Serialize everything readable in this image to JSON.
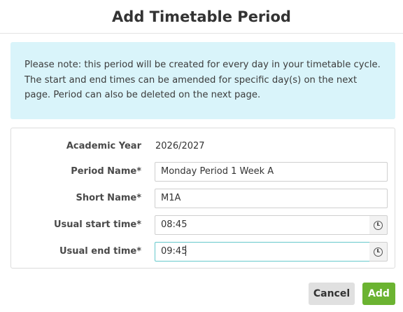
{
  "dialog": {
    "title": "Add Timetable Period"
  },
  "notice": {
    "text": "Please note: this period will be created for every day in your timetable cycle. The start and end times can be amended for specific day(s) on the next page. Period can also be deleted on the next page."
  },
  "form": {
    "academic_year_label": "Academic Year",
    "academic_year_value": "2026/2027",
    "period_name_label": "Period Name*",
    "period_name_value": "Monday Period 1 Week A",
    "short_name_label": "Short Name*",
    "short_name_value": "M1A",
    "start_time_label": "Usual start time*",
    "start_time_value": "08:45",
    "start_time_icon": "clock-icon",
    "end_time_label": "Usual end time*",
    "end_time_value": "09:45",
    "end_time_icon": "clock-icon"
  },
  "footer": {
    "cancel_label": "Cancel",
    "add_label": "Add"
  },
  "colors": {
    "notice_background": "#d9f4fa",
    "add_button": "#6bb331",
    "cancel_button": "#e0e0e0",
    "focus_border": "#66c9cc"
  }
}
